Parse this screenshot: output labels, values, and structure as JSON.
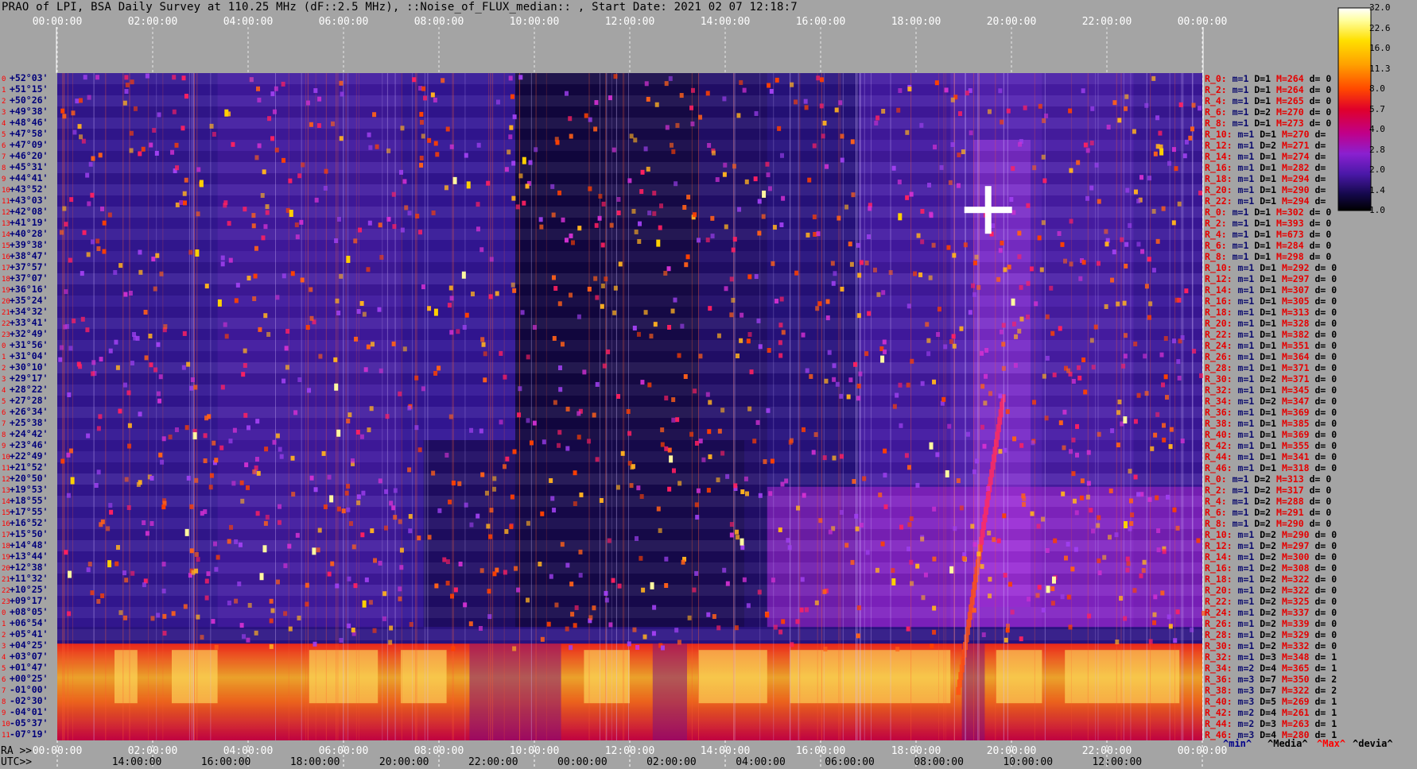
{
  "title": "PRAO of LPI, BSA Daily Survey at 110.25 MHz (dF::2.5 MHz), ::Noise_of_FLUX_median:: , Start Date: 2021 02 07 12:18:7",
  "chart_data": {
    "type": "heatmap",
    "top_time_labels": [
      "00:00:00",
      "02:00:00",
      "04:00:00",
      "06:00:00",
      "08:00:00",
      "10:00:00",
      "12:00:00",
      "14:00:00",
      "16:00:00",
      "18:00:00",
      "20:00:00",
      "22:00:00",
      "00:00:00"
    ],
    "ra_prefix": "RA >>",
    "ra_labels": [
      "00:00:00",
      "02:00:00",
      "04:00:00",
      "06:00:00",
      "08:00:00",
      "10:00:00",
      "12:00:00",
      "14:00:00",
      "16:00:00",
      "18:00:00",
      "20:00:00",
      "22:00:00",
      "00:00:00"
    ],
    "utc_prefix": "UTC>>",
    "utc_labels": [
      "14:00:00",
      "16:00:00",
      "18:00:00",
      "20:00:00",
      "22:00:00",
      "00:00:00",
      "02:00:00",
      "04:00:00",
      "06:00:00",
      "08:00:00",
      "10:00:00",
      "12:00:00"
    ],
    "dec_labels": [
      "+52°03'",
      "+51°15'",
      "+50°26'",
      "+49°38'",
      "+48°46'",
      "+47°58'",
      "+47°09'",
      "+46°20'",
      "+45°31'",
      "+44°41'",
      "+43°52'",
      "+43°03'",
      "+42°08'",
      "+41°19'",
      "+40°28'",
      "+39°38'",
      "+38°47'",
      "+37°57'",
      "+37°07'",
      "+36°16'",
      "+35°24'",
      "+34°32'",
      "+33°41'",
      "+32°49'",
      "+31°56'",
      "+31°04'",
      "+30°10'",
      "+29°17'",
      "+28°22'",
      "+27°28'",
      "+26°34'",
      "+25°38'",
      "+24°42'",
      "+23°46'",
      "+22°49'",
      "+21°52'",
      "+20°50'",
      "+19°53'",
      "+18°55'",
      "+17°55'",
      "+16°52'",
      "+15°50'",
      "+14°48'",
      "+13°44'",
      "+12°38'",
      "+11°32'",
      "+10°25'",
      "+09°17'",
      "+08°05'",
      "+06°54'",
      "+05°41'",
      "+04°25'",
      "+03°07'",
      "+01°47'",
      "+00°25'",
      "-01°00'",
      "-02°30'",
      "-04°01'",
      "-05°37'",
      "-07°19'"
    ],
    "colorbar": {
      "ticks": [
        "32.0",
        "22.6",
        "16.0",
        "11.3",
        "8.0",
        "5.7",
        "4.0",
        "2.8",
        "2.0",
        "1.4",
        "1.0"
      ],
      "colors": [
        "#ffffff",
        "#ffffa0",
        "#ffe000",
        "#ffa000",
        "#ff4800",
        "#e0002a",
        "#c0008a",
        "#8a20d0",
        "#4a18a8",
        "#14084a",
        "#000000"
      ]
    },
    "row_stats": [
      {
        "r": "R_0:",
        "m": "m=1",
        "d": "D=1",
        "mm": "M=264",
        "dv": "d= 0"
      },
      {
        "r": "R_2:",
        "m": "m=1",
        "d": "D=1",
        "mm": "M=264",
        "dv": "d= 0"
      },
      {
        "r": "R_4:",
        "m": "m=1",
        "d": "D=1",
        "mm": "M=265",
        "dv": "d= 0"
      },
      {
        "r": "R_6:",
        "m": "m=1",
        "d": "D=2",
        "mm": "M=270",
        "dv": "d= 0"
      },
      {
        "r": "R_8:",
        "m": "m=1",
        "d": "D=1",
        "mm": "M=273",
        "dv": "d= 0"
      },
      {
        "r": "R_10:",
        "m": "m=1",
        "d": "D=1",
        "mm": "M=270",
        "dv": "d="
      },
      {
        "r": "R_12:",
        "m": "m=1",
        "d": "D=2",
        "mm": "M=271",
        "dv": "d="
      },
      {
        "r": "R_14:",
        "m": "m=1",
        "d": "D=1",
        "mm": "M=274",
        "dv": "d="
      },
      {
        "r": "R_16:",
        "m": "m=1",
        "d": "D=1",
        "mm": "M=282",
        "dv": "d="
      },
      {
        "r": "R_18:",
        "m": "m=1",
        "d": "D=1",
        "mm": "M=294",
        "dv": "d="
      },
      {
        "r": "R_20:",
        "m": "m=1",
        "d": "D=1",
        "mm": "M=290",
        "dv": "d="
      },
      {
        "r": "R_22:",
        "m": "m=1",
        "d": "D=1",
        "mm": "M=294",
        "dv": "d="
      },
      {
        "r": "R_0:",
        "m": "m=1",
        "d": "D=1",
        "mm": "M=302",
        "dv": "d= 0"
      },
      {
        "r": "R_2:",
        "m": "m=1",
        "d": "D=1",
        "mm": "M=393",
        "dv": "d= 0"
      },
      {
        "r": "R_4:",
        "m": "m=1",
        "d": "D=1",
        "mm": "M=673",
        "dv": "d= 0"
      },
      {
        "r": "R_6:",
        "m": "m=1",
        "d": "D=1",
        "mm": "M=284",
        "dv": "d= 0"
      },
      {
        "r": "R_8:",
        "m": "m=1",
        "d": "D=1",
        "mm": "M=298",
        "dv": "d= 0"
      },
      {
        "r": "R_10:",
        "m": "m=1",
        "d": "D=1",
        "mm": "M=292",
        "dv": "d= 0"
      },
      {
        "r": "R_12:",
        "m": "m=1",
        "d": "D=1",
        "mm": "M=297",
        "dv": "d= 0"
      },
      {
        "r": "R_14:",
        "m": "m=1",
        "d": "D=1",
        "mm": "M=307",
        "dv": "d= 0"
      },
      {
        "r": "R_16:",
        "m": "m=1",
        "d": "D=1",
        "mm": "M=305",
        "dv": "d= 0"
      },
      {
        "r": "R_18:",
        "m": "m=1",
        "d": "D=1",
        "mm": "M=313",
        "dv": "d= 0"
      },
      {
        "r": "R_20:",
        "m": "m=1",
        "d": "D=1",
        "mm": "M=328",
        "dv": "d= 0"
      },
      {
        "r": "R_22:",
        "m": "m=1",
        "d": "D=1",
        "mm": "M=382",
        "dv": "d= 0"
      },
      {
        "r": "R_24:",
        "m": "m=1",
        "d": "D=1",
        "mm": "M=351",
        "dv": "d= 0"
      },
      {
        "r": "R_26:",
        "m": "m=1",
        "d": "D=1",
        "mm": "M=364",
        "dv": "d= 0"
      },
      {
        "r": "R_28:",
        "m": "m=1",
        "d": "D=1",
        "mm": "M=371",
        "dv": "d= 0"
      },
      {
        "r": "R_30:",
        "m": "m=1",
        "d": "D=2",
        "mm": "M=371",
        "dv": "d= 0"
      },
      {
        "r": "R_32:",
        "m": "m=1",
        "d": "D=1",
        "mm": "M=345",
        "dv": "d= 0"
      },
      {
        "r": "R_34:",
        "m": "m=1",
        "d": "D=2",
        "mm": "M=347",
        "dv": "d= 0"
      },
      {
        "r": "R_36:",
        "m": "m=1",
        "d": "D=1",
        "mm": "M=369",
        "dv": "d= 0"
      },
      {
        "r": "R_38:",
        "m": "m=1",
        "d": "D=1",
        "mm": "M=385",
        "dv": "d= 0"
      },
      {
        "r": "R_40:",
        "m": "m=1",
        "d": "D=1",
        "mm": "M=369",
        "dv": "d= 0"
      },
      {
        "r": "R_42:",
        "m": "m=1",
        "d": "D=1",
        "mm": "M=355",
        "dv": "d= 0"
      },
      {
        "r": "R_44:",
        "m": "m=1",
        "d": "D=1",
        "mm": "M=341",
        "dv": "d= 0"
      },
      {
        "r": "R_46:",
        "m": "m=1",
        "d": "D=1",
        "mm": "M=318",
        "dv": "d= 0"
      },
      {
        "r": "R_0:",
        "m": "m=1",
        "d": "D=2",
        "mm": "M=313",
        "dv": "d= 0"
      },
      {
        "r": "R_2:",
        "m": "m=1",
        "d": "D=2",
        "mm": "M=317",
        "dv": "d= 0"
      },
      {
        "r": "R_4:",
        "m": "m=1",
        "d": "D=2",
        "mm": "M=288",
        "dv": "d= 0"
      },
      {
        "r": "R_6:",
        "m": "m=1",
        "d": "D=2",
        "mm": "M=291",
        "dv": "d= 0"
      },
      {
        "r": "R_8:",
        "m": "m=1",
        "d": "D=2",
        "mm": "M=290",
        "dv": "d= 0"
      },
      {
        "r": "R_10:",
        "m": "m=1",
        "d": "D=2",
        "mm": "M=290",
        "dv": "d= 0"
      },
      {
        "r": "R_12:",
        "m": "m=1",
        "d": "D=2",
        "mm": "M=297",
        "dv": "d= 0"
      },
      {
        "r": "R_14:",
        "m": "m=1",
        "d": "D=2",
        "mm": "M=300",
        "dv": "d= 0"
      },
      {
        "r": "R_16:",
        "m": "m=1",
        "d": "D=2",
        "mm": "M=308",
        "dv": "d= 0"
      },
      {
        "r": "R_18:",
        "m": "m=1",
        "d": "D=2",
        "mm": "M=322",
        "dv": "d= 0"
      },
      {
        "r": "R_20:",
        "m": "m=1",
        "d": "D=2",
        "mm": "M=322",
        "dv": "d= 0"
      },
      {
        "r": "R_22:",
        "m": "m=1",
        "d": "D=2",
        "mm": "M=325",
        "dv": "d= 0"
      },
      {
        "r": "R_24:",
        "m": "m=1",
        "d": "D=2",
        "mm": "M=337",
        "dv": "d= 0"
      },
      {
        "r": "R_26:",
        "m": "m=1",
        "d": "D=2",
        "mm": "M=339",
        "dv": "d= 0"
      },
      {
        "r": "R_28:",
        "m": "m=1",
        "d": "D=2",
        "mm": "M=329",
        "dv": "d= 0"
      },
      {
        "r": "R_30:",
        "m": "m=1",
        "d": "D=2",
        "mm": "M=332",
        "dv": "d= 0"
      },
      {
        "r": "R_32:",
        "m": "m=1",
        "d": "D=3",
        "mm": "M=348",
        "dv": "d= 1"
      },
      {
        "r": "R_34:",
        "m": "m=2",
        "d": "D=4",
        "mm": "M=365",
        "dv": "d= 1"
      },
      {
        "r": "R_36:",
        "m": "m=3",
        "d": "D=7",
        "mm": "M=350",
        "dv": "d= 2"
      },
      {
        "r": "R_38:",
        "m": "m=3",
        "d": "D=7",
        "mm": "M=322",
        "dv": "d= 2"
      },
      {
        "r": "R_40:",
        "m": "m=3",
        "d": "D=5",
        "mm": "M=269",
        "dv": "d= 1"
      },
      {
        "r": "R_42:",
        "m": "m=2",
        "d": "D=4",
        "mm": "M=261",
        "dv": "d= 1"
      },
      {
        "r": "R_44:",
        "m": "m=2",
        "d": "D=3",
        "mm": "M=263",
        "dv": "d= 1"
      },
      {
        "r": "R_46:",
        "m": "m=3",
        "d": "D=4",
        "mm": "M=280",
        "dv": "d= 1"
      }
    ]
  },
  "legend": {
    "min": "^min^",
    "median": "^Media^",
    "max": "^Max^",
    "deviation": "^devia^"
  }
}
